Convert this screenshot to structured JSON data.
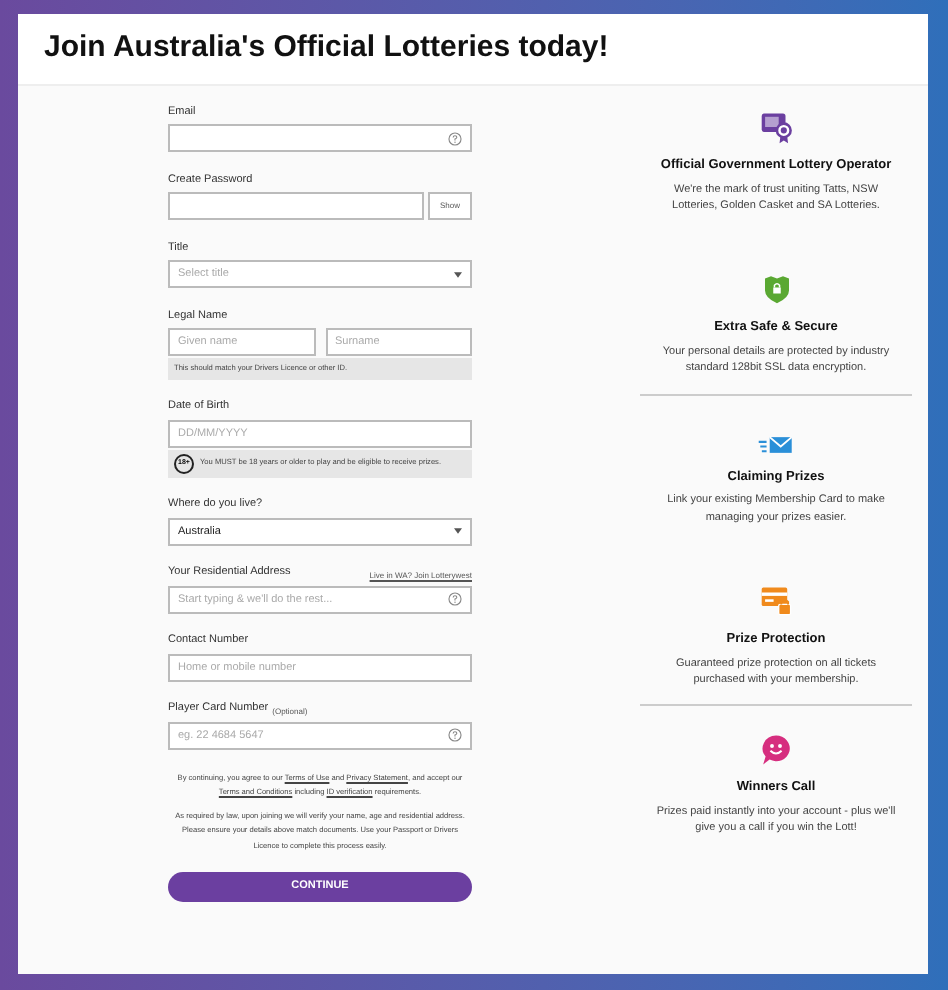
{
  "title": "Join Australia's Official Lotteries today!",
  "fields": [
    {
      "kind": "text",
      "label": "Email",
      "help": true
    },
    {
      "kind": "password",
      "label": "Create Password",
      "button": "Show"
    },
    {
      "kind": "select",
      "label": "Title",
      "placeholder": "Select title"
    },
    {
      "kind": "name",
      "label": "Legal Name",
      "placeholders": [
        "Given name",
        "Surname"
      ],
      "hint": "This should match your Drivers Licence or other ID."
    },
    {
      "kind": "text",
      "label": "Date of Birth",
      "placeholder": "DD/MM/YYYY",
      "badge": "18+",
      "note": "You MUST be 18 years or older to play and be eligible to receive prizes."
    },
    {
      "kind": "select",
      "label": "Where do you live?",
      "value": "Australia"
    },
    {
      "kind": "text",
      "label": "Your Residential Address",
      "link": "Live in WA? Join Lotterywest",
      "placeholder": "Start typing & we'll do the rest...",
      "help": true
    },
    {
      "kind": "text",
      "label": "Contact Number",
      "placeholder": "Home or mobile number"
    },
    {
      "kind": "text",
      "label": "Player Card Number",
      "optional": "(Optional)",
      "placeholder": "eg. 22 4684 5647",
      "help": true
    }
  ],
  "consent": [
    {
      "text": "By continuing, you agree to our "
    },
    {
      "link": "Terms of Use"
    },
    {
      "text": " and "
    },
    {
      "link": "Privacy Statement"
    },
    {
      "text": ", and accept our "
    },
    {
      "link": "Terms and Conditions"
    },
    {
      "text": " including "
    },
    {
      "link": "ID verification"
    },
    {
      "text": " requirements."
    }
  ],
  "legal": "As required by law, upon joining we will verify your name, age and residential address. Please ensure your details above match documents. Use your Passport or Drivers Licence to complete this process easily.",
  "button": "CONTINUE",
  "features": [
    {
      "color": "#6b3fa0",
      "heading": "Official Government Lottery Operator",
      "text": "We're the mark of trust uniting Tatts, NSW Lotteries, Golden Casket and SA Lotteries.",
      "divider_after": false
    },
    {
      "color": "#5aa832",
      "heading": "Extra Safe & Secure",
      "text": "Your personal details are protected by industry standard 128bit SSL data encryption.",
      "divider_after": true
    },
    {
      "color": "#2a8fd8",
      "heading": "Claiming Prizes",
      "text": "Link your existing Membership Card to make managing your prizes easier.",
      "divider_after": false
    },
    {
      "color": "#f08a1c",
      "heading": "Prize Protection",
      "text": "Guaranteed prize protection on all tickets purchased with your membership.",
      "divider_after": true
    },
    {
      "color": "#d62e7f",
      "heading": "Winners Call",
      "text": "Prizes paid instantly into your account - plus we'll give you a call if you win the Lott!",
      "divider_after": false
    }
  ]
}
